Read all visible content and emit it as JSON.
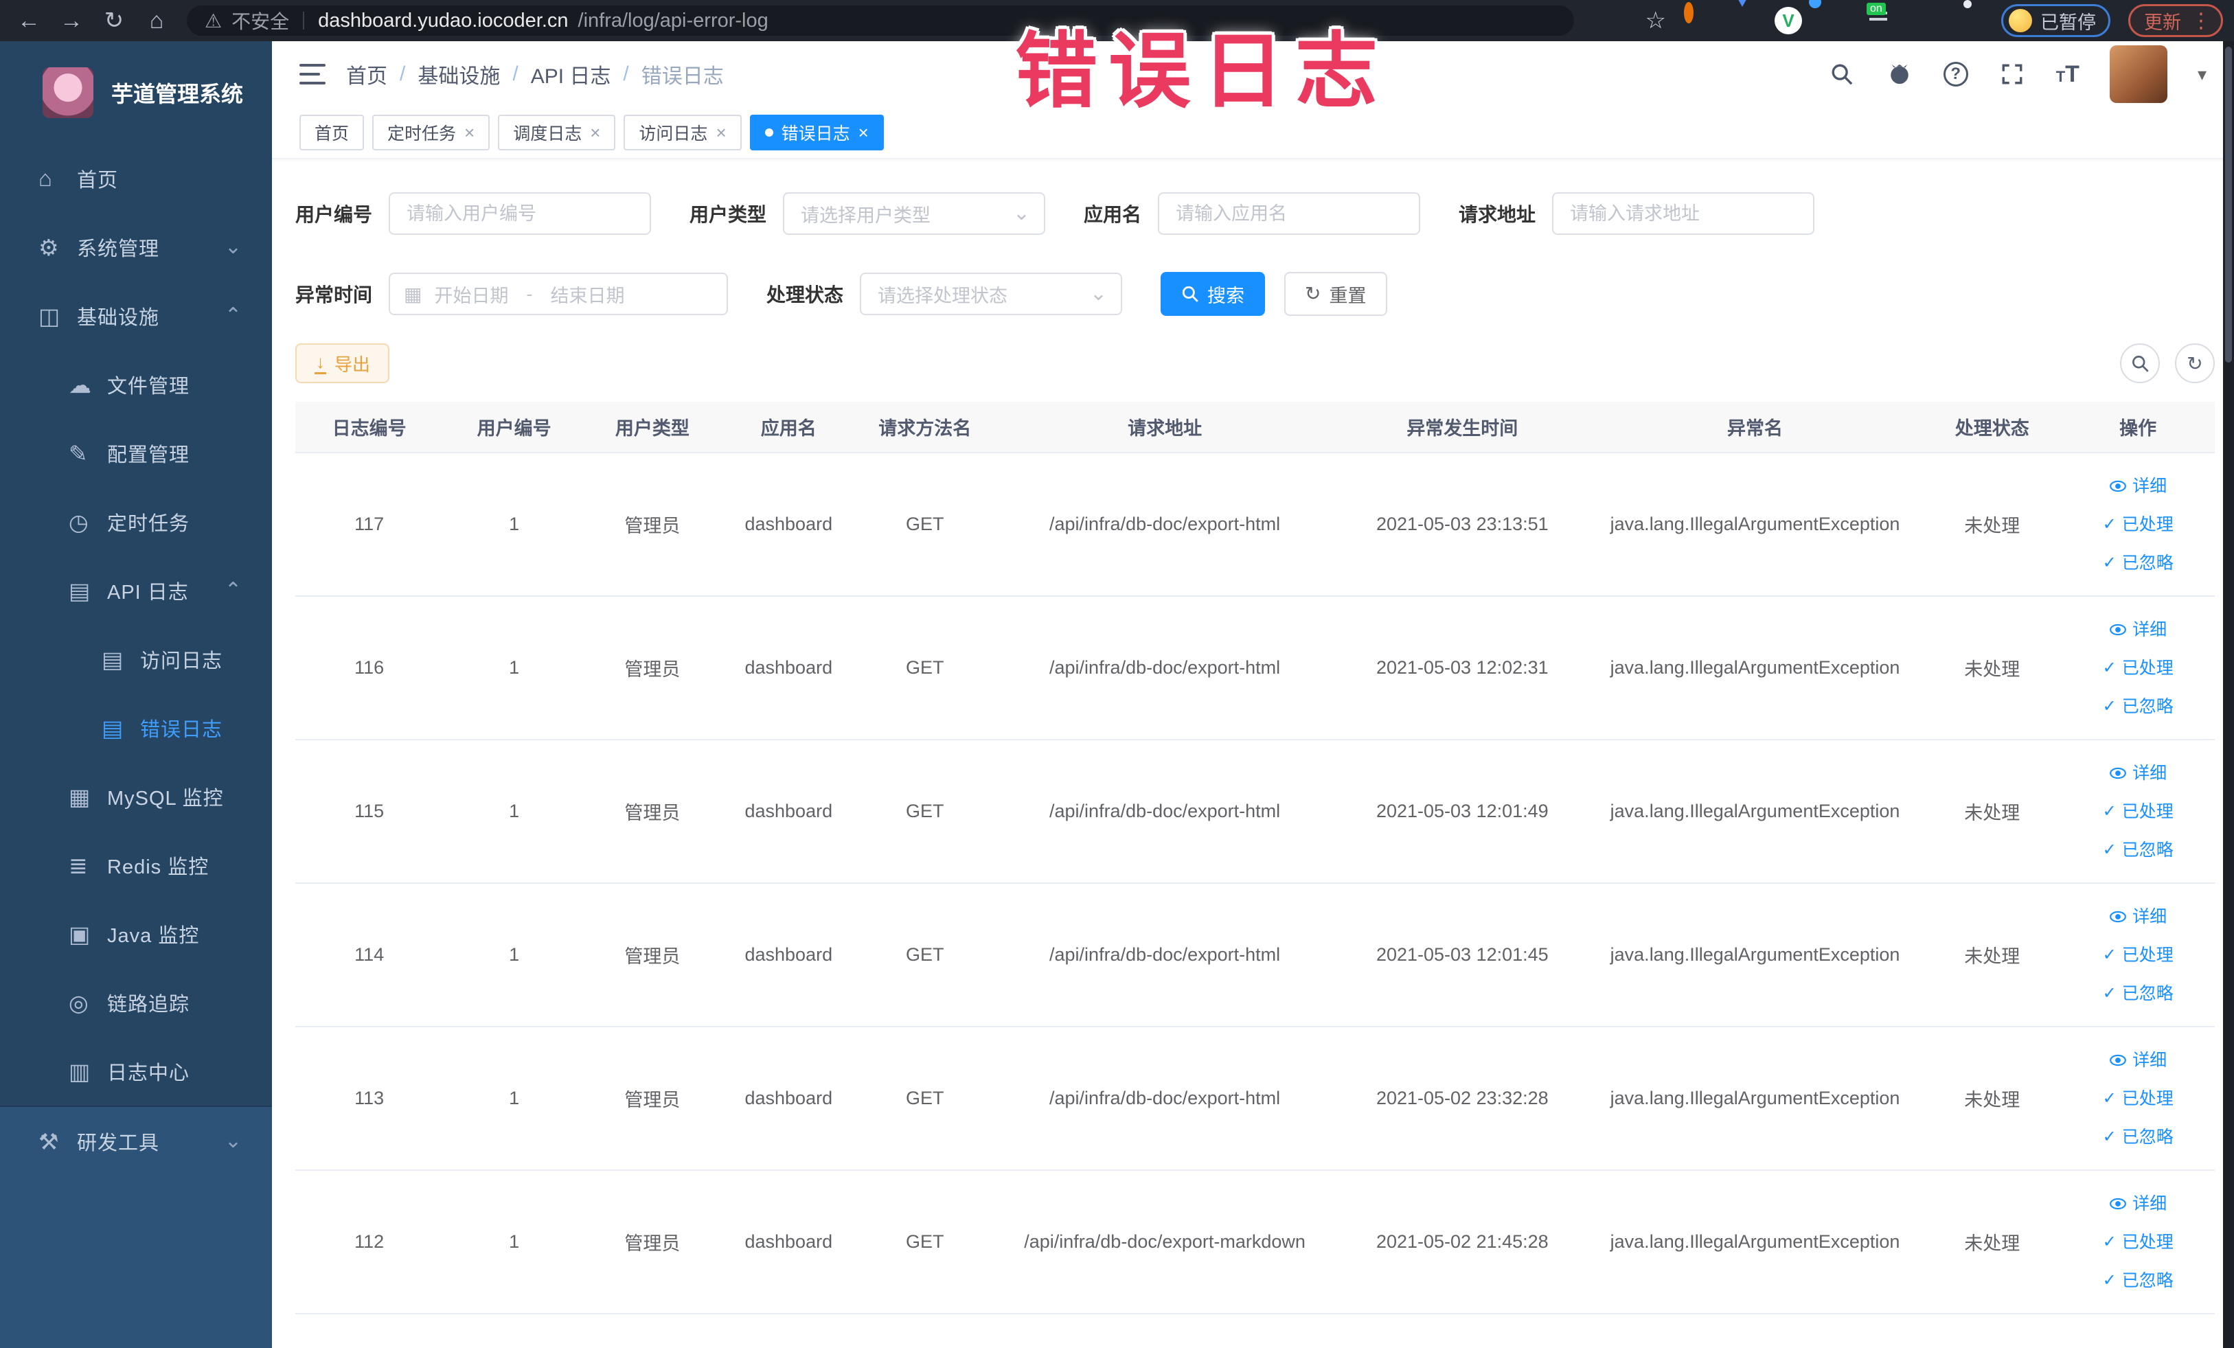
{
  "browser": {
    "security_label": "不安全",
    "url_domain": "dashboard.yudao.iocoder.cn",
    "url_path": "/infra/log/api-error-log",
    "profile_badge": "已暂停",
    "update_badge": "更新"
  },
  "watermark": "错误日志",
  "sidebar": {
    "title": "芋道管理系统",
    "items": [
      {
        "id": "home",
        "label": "首页",
        "icon": "home-icon",
        "glyph": "⌂",
        "level": 0
      },
      {
        "id": "system",
        "label": "系统管理",
        "icon": "gear-icon",
        "glyph": "⚙",
        "level": 0,
        "chevron": "down"
      },
      {
        "id": "infra",
        "label": "基础设施",
        "icon": "infra-icon",
        "glyph": "◫",
        "level": 0,
        "chevron": "up"
      },
      {
        "id": "files",
        "label": "文件管理",
        "icon": "cloud-icon",
        "glyph": "☁",
        "level": 1
      },
      {
        "id": "config",
        "label": "配置管理",
        "icon": "edit-icon",
        "glyph": "✎",
        "level": 1
      },
      {
        "id": "jobs",
        "label": "定时任务",
        "icon": "clock-icon",
        "glyph": "◷",
        "level": 1
      },
      {
        "id": "api-log",
        "label": "API 日志",
        "icon": "api-log-icon",
        "glyph": "▤",
        "level": 1,
        "chevron": "up"
      },
      {
        "id": "access-log",
        "label": "访问日志",
        "icon": "access-log-icon",
        "glyph": "▤",
        "level": 2
      },
      {
        "id": "error-log",
        "label": "错误日志",
        "icon": "error-log-icon",
        "glyph": "▤",
        "level": 2,
        "active": true
      },
      {
        "id": "mysql-monitor",
        "label": "MySQL 监控",
        "icon": "mysql-monitor-icon",
        "glyph": "▦",
        "level": 1
      },
      {
        "id": "redis-monitor",
        "label": "Redis 监控",
        "icon": "redis-monitor-icon",
        "glyph": "≣",
        "level": 1
      },
      {
        "id": "java-monitor",
        "label": "Java 监控",
        "icon": "java-monitor-icon",
        "glyph": "▣",
        "level": 1
      },
      {
        "id": "trace",
        "label": "链路追踪",
        "icon": "trace-icon",
        "glyph": "◎",
        "level": 1
      },
      {
        "id": "log-center",
        "label": "日志中心",
        "icon": "log-center-icon",
        "glyph": "▥",
        "level": 1
      },
      {
        "id": "devtools",
        "label": "研发工具",
        "icon": "tools-icon",
        "glyph": "⚒",
        "level": 0,
        "chevron": "down",
        "section": "light"
      }
    ]
  },
  "header": {
    "breadcrumbs": [
      "首页",
      "基础设施",
      "API 日志",
      "错误日志"
    ]
  },
  "tabs": [
    {
      "label": "首页",
      "closable": false,
      "active": false
    },
    {
      "label": "定时任务",
      "closable": true,
      "active": false
    },
    {
      "label": "调度日志",
      "closable": true,
      "active": false
    },
    {
      "label": "访问日志",
      "closable": true,
      "active": false
    },
    {
      "label": "错误日志",
      "closable": true,
      "active": true
    }
  ],
  "filters": {
    "row1": [
      {
        "id": "user-id",
        "label": "用户编号",
        "placeholder": "请输入用户编号",
        "type": "input"
      },
      {
        "id": "user-type",
        "label": "用户类型",
        "placeholder": "请选择用户类型",
        "type": "select"
      },
      {
        "id": "app-name",
        "label": "应用名",
        "placeholder": "请输入应用名",
        "type": "input"
      },
      {
        "id": "request-url",
        "label": "请求地址",
        "placeholder": "请输入请求地址",
        "type": "input"
      }
    ],
    "time_label": "异常时间",
    "time_start_placeholder": "开始日期",
    "time_separator": "-",
    "time_end_placeholder": "结束日期",
    "status_label": "处理状态",
    "status_placeholder": "请选择处理状态",
    "search_label": "搜索",
    "reset_label": "重置"
  },
  "toolbar": {
    "export_label": "导出"
  },
  "table": {
    "columns": [
      "日志编号",
      "用户编号",
      "用户类型",
      "应用名",
      "请求方法名",
      "请求地址",
      "异常发生时间",
      "异常名",
      "处理状态",
      "操作"
    ],
    "action_labels": [
      "详细",
      "已处理",
      "已忽略"
    ],
    "rows": [
      {
        "id": "117",
        "user_id": "1",
        "user_type": "管理员",
        "app_name": "dashboard",
        "method": "GET",
        "url": "/api/infra/db-doc/export-html",
        "time": "2021-05-03 23:13:51",
        "exception": "java.lang.IllegalArgumentException",
        "status": "未处理"
      },
      {
        "id": "116",
        "user_id": "1",
        "user_type": "管理员",
        "app_name": "dashboard",
        "method": "GET",
        "url": "/api/infra/db-doc/export-html",
        "time": "2021-05-03 12:02:31",
        "exception": "java.lang.IllegalArgumentException",
        "status": "未处理"
      },
      {
        "id": "115",
        "user_id": "1",
        "user_type": "管理员",
        "app_name": "dashboard",
        "method": "GET",
        "url": "/api/infra/db-doc/export-html",
        "time": "2021-05-03 12:01:49",
        "exception": "java.lang.IllegalArgumentException",
        "status": "未处理"
      },
      {
        "id": "114",
        "user_id": "1",
        "user_type": "管理员",
        "app_name": "dashboard",
        "method": "GET",
        "url": "/api/infra/db-doc/export-html",
        "time": "2021-05-03 12:01:45",
        "exception": "java.lang.IllegalArgumentException",
        "status": "未处理"
      },
      {
        "id": "113",
        "user_id": "1",
        "user_type": "管理员",
        "app_name": "dashboard",
        "method": "GET",
        "url": "/api/infra/db-doc/export-html",
        "time": "2021-05-02 23:32:28",
        "exception": "java.lang.IllegalArgumentException",
        "status": "未处理"
      },
      {
        "id": "112",
        "user_id": "1",
        "user_type": "管理员",
        "app_name": "dashboard",
        "method": "GET",
        "url": "/api/infra/db-doc/export-markdown",
        "time": "2021-05-02 21:45:28",
        "exception": "java.lang.IllegalArgumentException",
        "status": "未处理"
      }
    ]
  },
  "colors": {
    "accent": "#1890ff",
    "sidebar_bg": "#254563",
    "sidebar_active": "#3f9eff",
    "export_text": "#e6a23c",
    "watermark": "#ea3a5f"
  }
}
